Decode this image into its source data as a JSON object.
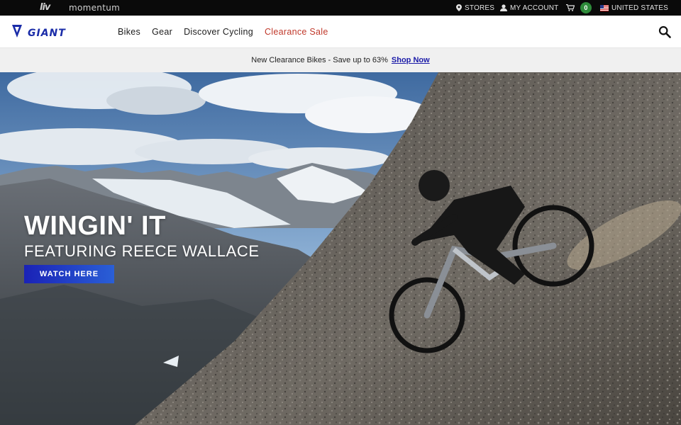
{
  "topbar": {
    "brands": [
      "liv",
      "momentum"
    ],
    "stores_label": "STORES",
    "account_label": "MY ACCOUNT",
    "cart_count": "0",
    "country_label": "UNITED STATES"
  },
  "header": {
    "logo_text": "GIANT",
    "nav": [
      "Bikes",
      "Gear",
      "Discover Cycling",
      "Clearance Sale"
    ],
    "search_icon": "search-icon"
  },
  "promo": {
    "text": "New Clearance Bikes - Save up to 63%",
    "link_label": "Shop Now"
  },
  "hero": {
    "title": "WINGIN' IT",
    "subtitle": "FEATURING REECE WALLACE",
    "cta_label": "WATCH HERE"
  },
  "colors": {
    "brand_blue": "#1a2ca8",
    "sale_red": "#c0392b",
    "cart_green": "#2e8b3a",
    "cta_blue": "#1a22b6"
  }
}
